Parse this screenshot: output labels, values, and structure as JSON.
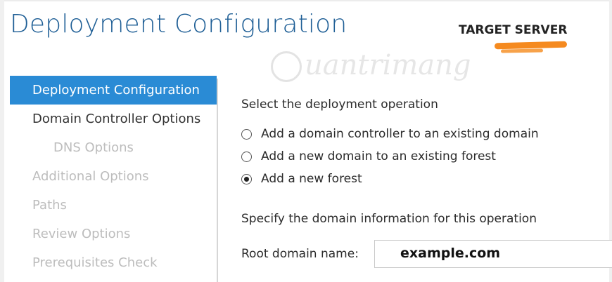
{
  "header": {
    "title": "Deployment Configuration",
    "target_label": "TARGET SERVER"
  },
  "watermark": {
    "text": "uantrimang"
  },
  "nav": {
    "items": [
      {
        "label": "Deployment Configuration",
        "state": "active"
      },
      {
        "label": "Domain Controller Options",
        "state": "normal"
      },
      {
        "label": "DNS Options",
        "state": "disabled",
        "indent": true
      },
      {
        "label": "Additional Options",
        "state": "disabled"
      },
      {
        "label": "Paths",
        "state": "disabled"
      },
      {
        "label": "Review Options",
        "state": "disabled"
      },
      {
        "label": "Prerequisites Check",
        "state": "disabled"
      }
    ]
  },
  "main": {
    "operation_prompt": "Select the deployment operation",
    "options": [
      {
        "label": "Add a domain controller to an existing domain",
        "checked": false
      },
      {
        "label": "Add a new domain to an existing forest",
        "checked": false
      },
      {
        "label": "Add a new forest",
        "checked": true
      }
    ],
    "domain_prompt": "Specify the domain information for this operation",
    "root_domain_label": "Root domain name:",
    "root_domain_value": "example.com"
  },
  "colors": {
    "title": "#1f5f96",
    "nav_active_bg": "#2a8bd5",
    "redaction": "#f58a1f"
  }
}
